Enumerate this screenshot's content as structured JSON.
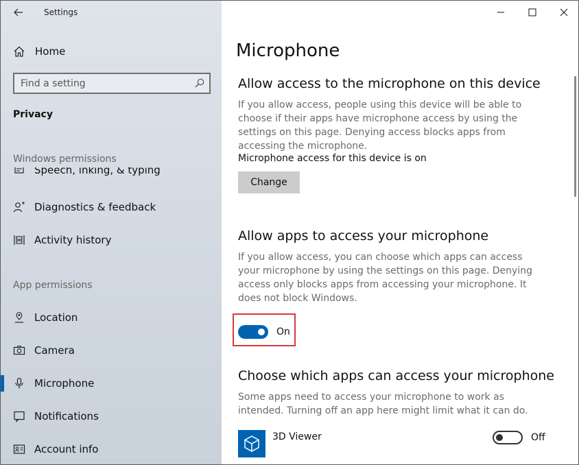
{
  "window": {
    "title": "Settings"
  },
  "sidebar": {
    "home_label": "Home",
    "search_placeholder": "Find a setting",
    "section_title": "Privacy",
    "windows_permissions_label": "Windows permissions",
    "windows_permissions_items": [
      {
        "label": "Speech, inking, & typing",
        "icon": "speech-icon"
      },
      {
        "label": "Diagnostics & feedback",
        "icon": "diagnostics-icon"
      },
      {
        "label": "Activity history",
        "icon": "activity-history-icon"
      }
    ],
    "app_permissions_label": "App permissions",
    "app_permissions_items": [
      {
        "label": "Location",
        "icon": "location-icon"
      },
      {
        "label": "Camera",
        "icon": "camera-icon"
      },
      {
        "label": "Microphone",
        "icon": "microphone-icon",
        "selected": true
      },
      {
        "label": "Notifications",
        "icon": "notifications-icon"
      },
      {
        "label": "Account info",
        "icon": "account-info-icon"
      }
    ]
  },
  "main": {
    "page_title": "Microphone",
    "device_access": {
      "heading": "Allow access to the microphone on this device",
      "description": "If you allow access, people using this device will be able to choose if their apps have microphone access by using the settings on this page. Denying access blocks apps from accessing the microphone.",
      "status": "Microphone access for this device is on",
      "change_label": "Change"
    },
    "app_access": {
      "heading": "Allow apps to access your microphone",
      "description": "If you allow access, you can choose which apps can access your microphone by using the settings on this page. Denying access only blocks apps from accessing your microphone. It does not block Windows.",
      "toggle_state": "On",
      "toggle_on": true
    },
    "choose_apps": {
      "heading": "Choose which apps can access your microphone",
      "description": "Some apps need to access your microphone to work as intended. Turning off an app here might limit what it can do.",
      "apps": [
        {
          "name": "3D Viewer",
          "toggle_state": "Off",
          "toggle_on": false,
          "icon": "3d-viewer-icon"
        }
      ]
    }
  },
  "colors": {
    "accent": "#0063b1",
    "highlight": "#d9373b",
    "sidebar_bg": "#d4dbe3"
  }
}
